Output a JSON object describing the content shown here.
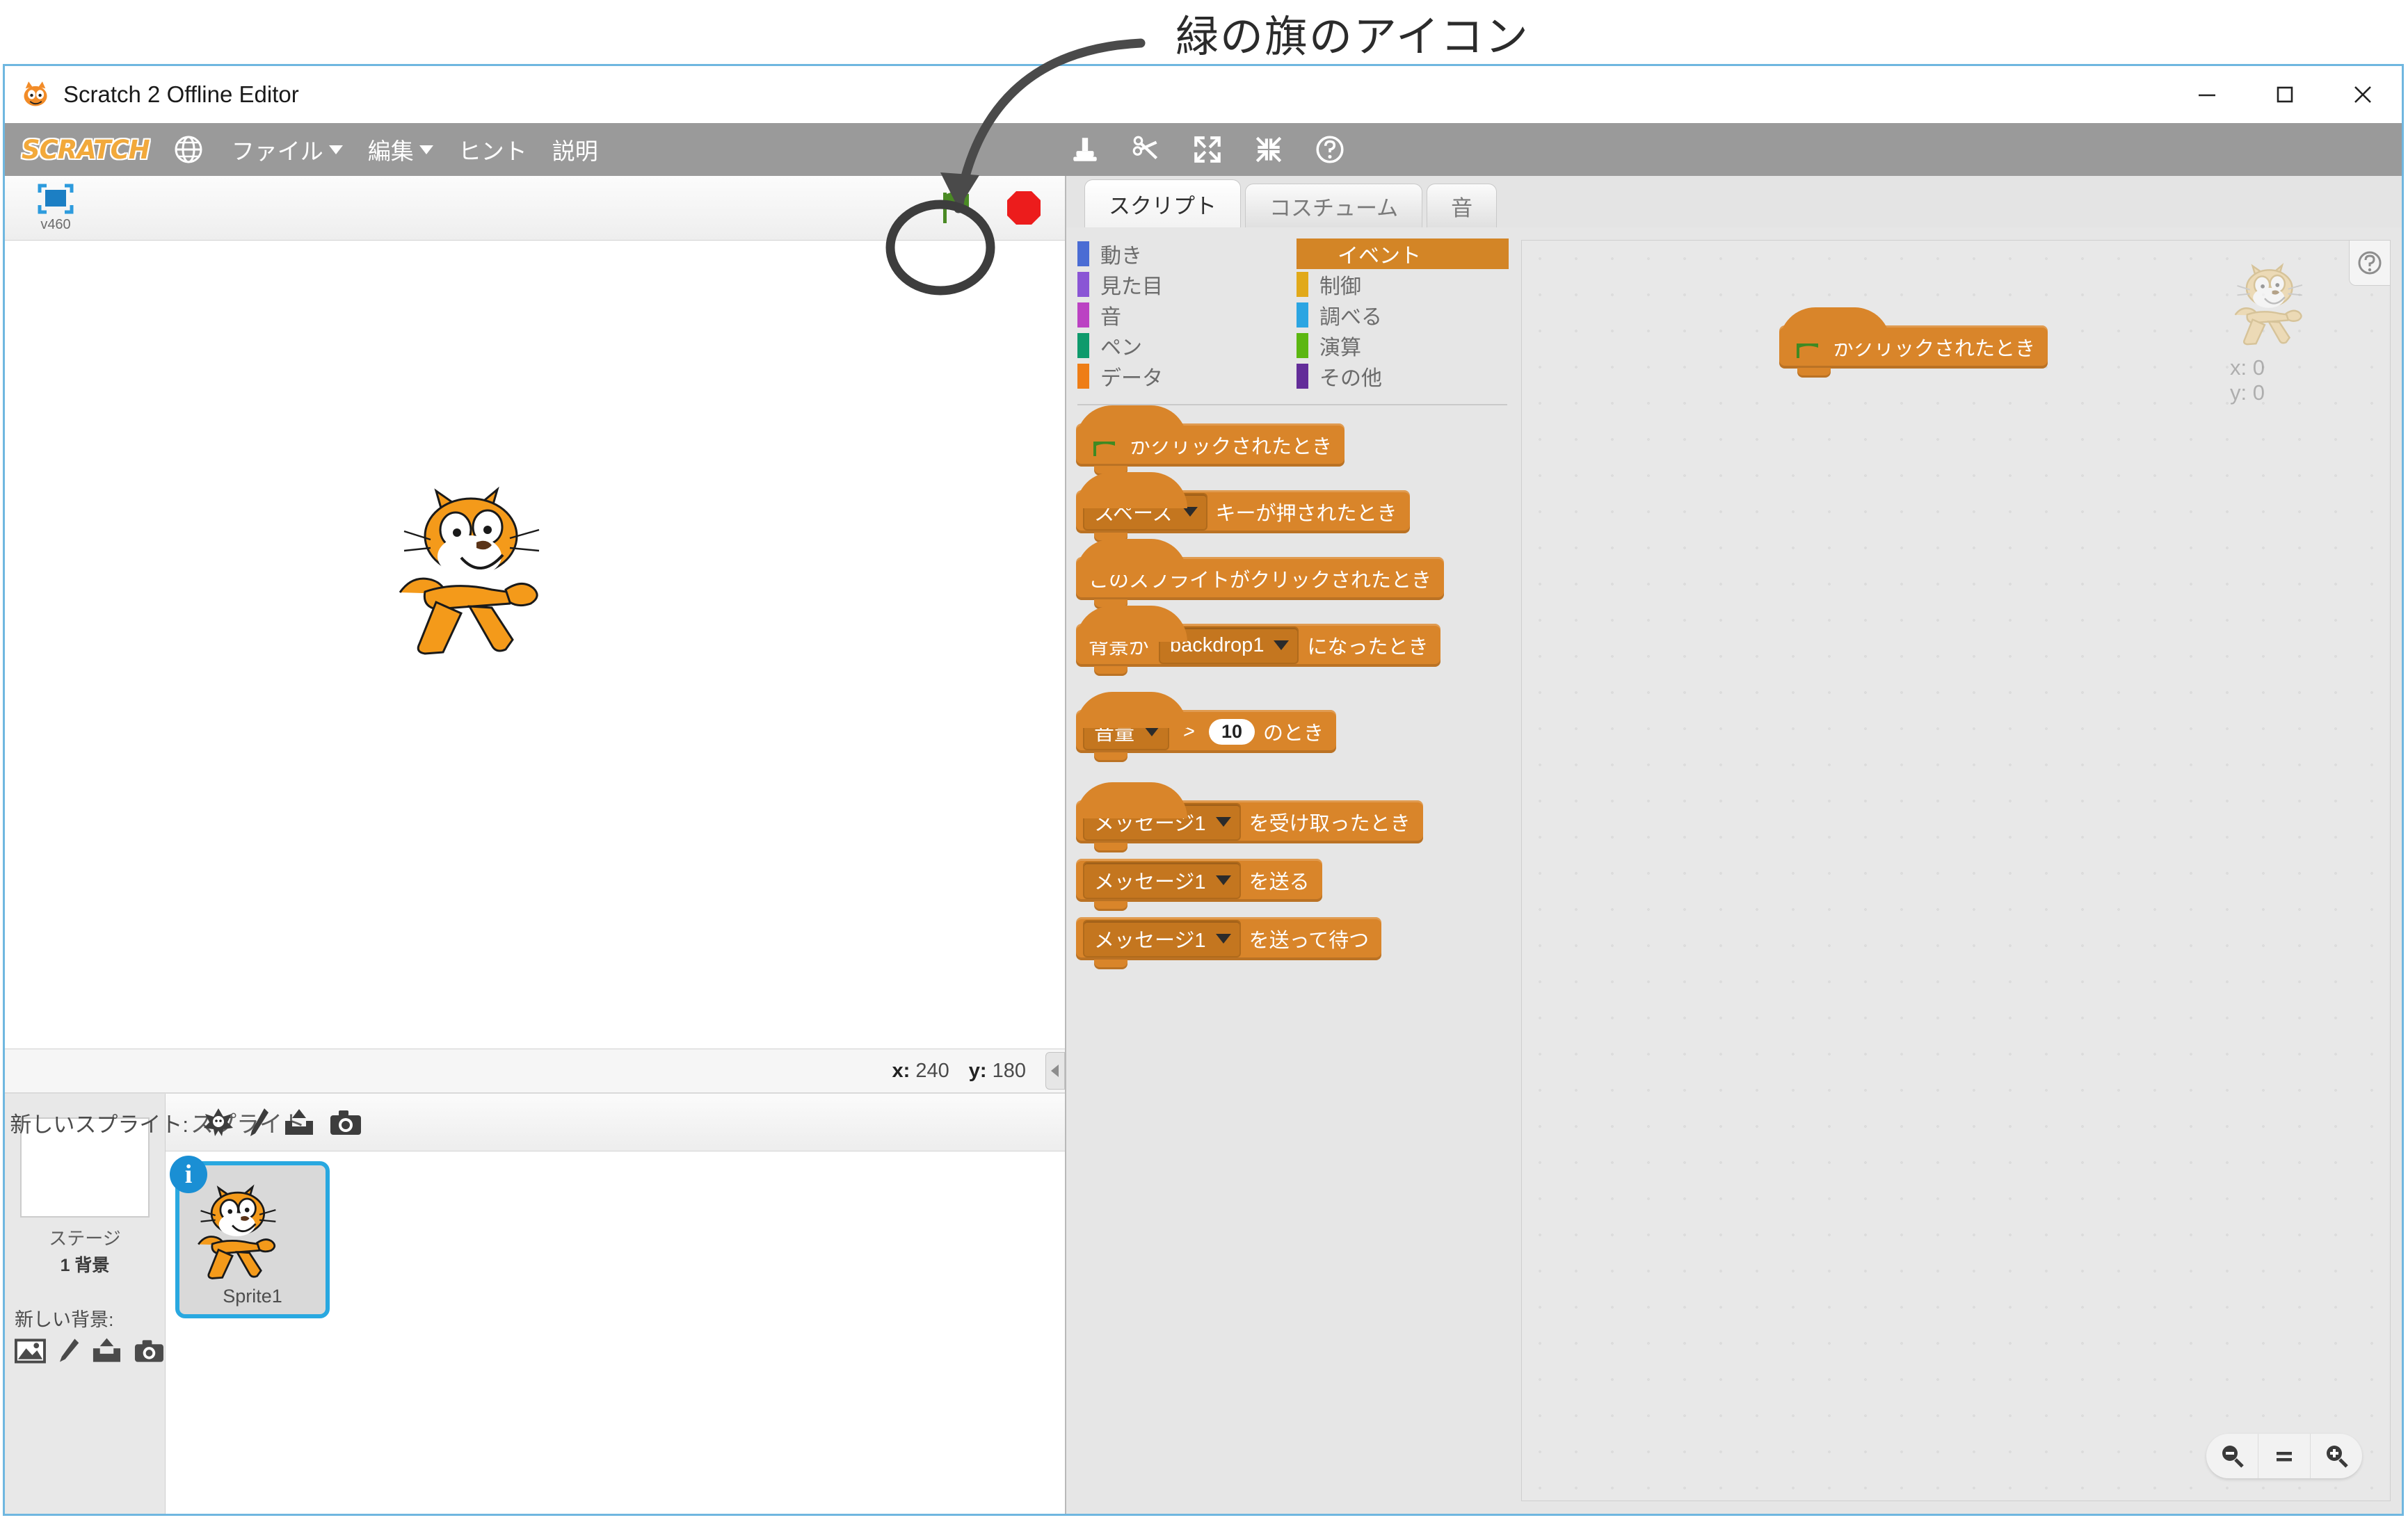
{
  "annotation": {
    "text": "緑の旗のアイコン",
    "target": "green-flag-icon"
  },
  "window": {
    "title": "Scratch 2 Offline Editor",
    "controls": {
      "minimize": "minimize-icon",
      "maximize": "maximize-icon",
      "close": "close-icon"
    }
  },
  "menubar": {
    "brand": "SCRATCH",
    "globe_icon": "globe-icon",
    "items": [
      {
        "label": "ファイル",
        "has_caret": true
      },
      {
        "label": "編集",
        "has_caret": true
      },
      {
        "label": "ヒント",
        "has_caret": false
      },
      {
        "label": "説明",
        "has_caret": false
      }
    ],
    "tools": [
      {
        "name": "stamp-duplicate-icon"
      },
      {
        "name": "scissors-delete-icon"
      },
      {
        "name": "grow-icon"
      },
      {
        "name": "shrink-icon"
      },
      {
        "name": "help-icon"
      }
    ]
  },
  "stage": {
    "fullscreen_label": "v460",
    "fullscreen_icon": "fullscreen-icon",
    "green_flag_icon": "green-flag-icon",
    "stop_icon": "stop-sign-icon",
    "coords": {
      "x_label": "x:",
      "x_value": "240",
      "y_label": "y:",
      "y_value": "180"
    },
    "collapse_icon": "collapse-left-arrow-icon"
  },
  "stage_panel": {
    "name": "ステージ",
    "backdrop_count": "1 背景",
    "new_backdrop_label": "新しい背景:",
    "icons": [
      {
        "name": "backdrop-library-icon"
      },
      {
        "name": "paint-backdrop-icon"
      },
      {
        "name": "upload-backdrop-icon"
      },
      {
        "name": "camera-backdrop-icon"
      }
    ]
  },
  "sprite_pane": {
    "title": "スプライト",
    "new_sprite_label": "新しいスプライト:",
    "new_sprite_icons": [
      {
        "name": "sprite-library-icon"
      },
      {
        "name": "paint-sprite-icon"
      },
      {
        "name": "upload-sprite-icon"
      },
      {
        "name": "camera-sprite-icon"
      }
    ],
    "sprites": [
      {
        "name": "Sprite1",
        "selected": true,
        "info_badge": "i"
      }
    ]
  },
  "tabs": [
    {
      "label": "スクリプト",
      "active": true
    },
    {
      "label": "コスチューム",
      "active": false
    },
    {
      "label": "音",
      "active": false
    }
  ],
  "palette": {
    "categories_left": [
      {
        "label": "動き",
        "color": "#4a6cd4",
        "selected": false
      },
      {
        "label": "見た目",
        "color": "#8a55d5",
        "selected": false
      },
      {
        "label": "音",
        "color": "#bb42c3",
        "selected": false
      },
      {
        "label": "ペン",
        "color": "#0e9a6c",
        "selected": false
      },
      {
        "label": "データ",
        "color": "#ee7d16",
        "selected": false
      }
    ],
    "categories_right": [
      {
        "label": "イベント",
        "color": "#c88330",
        "selected": true
      },
      {
        "label": "制御",
        "color": "#e1a91a",
        "selected": false
      },
      {
        "label": "調べる",
        "color": "#2ca5e2",
        "selected": false
      },
      {
        "label": "演算",
        "color": "#5cb712",
        "selected": false
      },
      {
        "label": "その他",
        "color": "#632d99",
        "selected": false
      }
    ],
    "blocks": [
      {
        "id": "whenflagclicked",
        "type": "hat",
        "icon": "green-flag-icon",
        "text": "がクリックされたとき"
      },
      {
        "id": "whenkeypressed",
        "type": "hat",
        "dropdown": "スペース",
        "text": "キーが押されたとき"
      },
      {
        "id": "whenclicked",
        "type": "hat",
        "text": "このスプライトがクリックされたとき"
      },
      {
        "id": "whenbackdropswitches",
        "type": "hat",
        "prefix": "背景が",
        "dropdown": "backdrop1",
        "text": "になったとき"
      },
      {
        "id": "whengreaterthan",
        "type": "hat",
        "dropdown": "音量",
        "operator": ">",
        "value": "10",
        "text": "のとき"
      },
      {
        "id": "whenireceive",
        "type": "hat",
        "dropdown": "メッセージ1",
        "text": "を受け取ったとき"
      },
      {
        "id": "broadcast",
        "type": "stack",
        "dropdown": "メッセージ1",
        "text": "を送る"
      },
      {
        "id": "broadcastandwait",
        "type": "stack",
        "dropdown": "メッセージ1",
        "text": "を送って待つ"
      }
    ]
  },
  "workspace": {
    "script_blocks": [
      {
        "id": "whenflagclicked",
        "type": "hat",
        "icon": "green-flag-icon",
        "text": "がクリックされたとき"
      }
    ],
    "watermark_sprite": "sprite-watermark-cat",
    "coords": {
      "x": "x: 0",
      "y": "y: 0"
    },
    "help_icon": "help-question-icon",
    "zoom_controls": [
      {
        "name": "zoom-out-icon"
      },
      {
        "name": "zoom-reset-icon"
      },
      {
        "name": "zoom-in-icon"
      }
    ]
  },
  "colors": {
    "events_block": "#d9852a",
    "menubar": "#9a9a9a",
    "window_border": "#6fb7e0",
    "selection": "#29a8e0",
    "flag_green": "#4a8a24",
    "stop_red": "#ec1c1c"
  }
}
